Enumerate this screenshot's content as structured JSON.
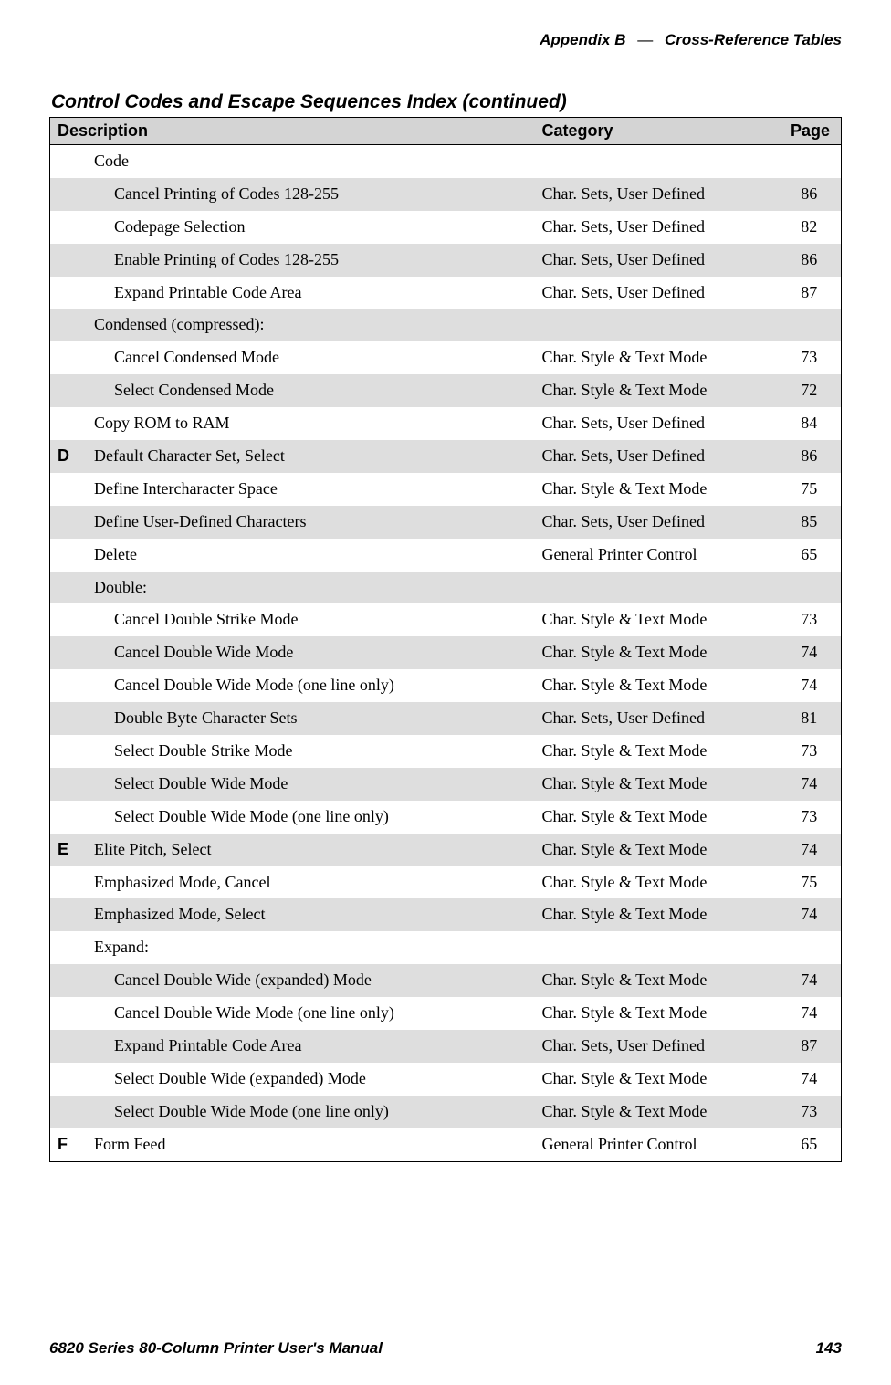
{
  "header": {
    "appendix": "Appendix B",
    "separator": "—",
    "title": "Cross-Reference Tables"
  },
  "table_title": "Control Codes and Escape Sequences Index (continued)",
  "columns": {
    "description": "Description",
    "category": "Category",
    "page": "Page"
  },
  "rows": [
    {
      "letter": "",
      "indent": 1,
      "desc": "Code",
      "cat": "",
      "page": "",
      "shade": false
    },
    {
      "letter": "",
      "indent": 2,
      "desc": "Cancel Printing of Codes 128-255",
      "cat": "Char. Sets, User Defined",
      "page": "86",
      "shade": true
    },
    {
      "letter": "",
      "indent": 2,
      "desc": "Codepage Selection",
      "cat": "Char. Sets, User Defined",
      "page": "82",
      "shade": false
    },
    {
      "letter": "",
      "indent": 2,
      "desc": "Enable Printing of Codes 128-255",
      "cat": "Char. Sets, User Defined",
      "page": "86",
      "shade": true
    },
    {
      "letter": "",
      "indent": 2,
      "desc": "Expand Printable Code Area",
      "cat": "Char. Sets, User Defined",
      "page": "87",
      "shade": false
    },
    {
      "letter": "",
      "indent": 1,
      "desc": "Condensed (compressed):",
      "cat": "",
      "page": "",
      "shade": true
    },
    {
      "letter": "",
      "indent": 2,
      "desc": "Cancel Condensed Mode",
      "cat": "Char. Style & Text Mode",
      "page": "73",
      "shade": false
    },
    {
      "letter": "",
      "indent": 2,
      "desc": "Select Condensed Mode",
      "cat": "Char. Style & Text Mode",
      "page": "72",
      "shade": true
    },
    {
      "letter": "",
      "indent": 1,
      "desc": "Copy ROM to RAM",
      "cat": "Char. Sets, User Defined",
      "page": "84",
      "shade": false
    },
    {
      "letter": "D",
      "indent": 1,
      "desc": "Default Character Set, Select",
      "cat": "Char. Sets, User Defined",
      "page": "86",
      "shade": true
    },
    {
      "letter": "",
      "indent": 1,
      "desc": "Define Intercharacter Space",
      "cat": "Char. Style & Text Mode",
      "page": "75",
      "shade": false
    },
    {
      "letter": "",
      "indent": 1,
      "desc": "Define User-Defined Characters",
      "cat": "Char. Sets, User Defined",
      "page": "85",
      "shade": true
    },
    {
      "letter": "",
      "indent": 1,
      "desc": "Delete",
      "cat": "General Printer Control",
      "page": "65",
      "shade": false
    },
    {
      "letter": "",
      "indent": 1,
      "desc": "Double:",
      "cat": "",
      "page": "",
      "shade": true
    },
    {
      "letter": "",
      "indent": 2,
      "desc": "Cancel Double Strike Mode",
      "cat": "Char. Style & Text Mode",
      "page": "73",
      "shade": false
    },
    {
      "letter": "",
      "indent": 2,
      "desc": "Cancel Double Wide Mode",
      "cat": "Char. Style & Text Mode",
      "page": "74",
      "shade": true
    },
    {
      "letter": "",
      "indent": 2,
      "desc": "Cancel Double Wide Mode (one line only)",
      "cat": "Char. Style & Text Mode",
      "page": "74",
      "shade": false
    },
    {
      "letter": "",
      "indent": 2,
      "desc": "Double Byte Character Sets",
      "cat": "Char. Sets, User Defined",
      "page": "81",
      "shade": true
    },
    {
      "letter": "",
      "indent": 2,
      "desc": "Select Double Strike Mode",
      "cat": "Char. Style & Text Mode",
      "page": "73",
      "shade": false
    },
    {
      "letter": "",
      "indent": 2,
      "desc": "Select Double Wide Mode",
      "cat": "Char. Style & Text Mode",
      "page": "74",
      "shade": true
    },
    {
      "letter": "",
      "indent": 2,
      "desc": "Select Double Wide Mode (one line only)",
      "cat": "Char. Style & Text Mode",
      "page": "73",
      "shade": false
    },
    {
      "letter": "E",
      "indent": 1,
      "desc": "Elite Pitch, Select",
      "cat": "Char. Style & Text Mode",
      "page": "74",
      "shade": true
    },
    {
      "letter": "",
      "indent": 1,
      "desc": "Emphasized Mode, Cancel",
      "cat": "Char. Style & Text Mode",
      "page": "75",
      "shade": false
    },
    {
      "letter": "",
      "indent": 1,
      "desc": "Emphasized Mode, Select",
      "cat": "Char. Style & Text Mode",
      "page": "74",
      "shade": true
    },
    {
      "letter": "",
      "indent": 1,
      "desc": "Expand:",
      "cat": "",
      "page": "",
      "shade": false
    },
    {
      "letter": "",
      "indent": 2,
      "desc": "Cancel Double Wide (expanded) Mode",
      "cat": "Char. Style & Text Mode",
      "page": "74",
      "shade": true
    },
    {
      "letter": "",
      "indent": 2,
      "desc": "Cancel Double Wide Mode (one line only)",
      "cat": "Char. Style & Text Mode",
      "page": "74",
      "shade": false
    },
    {
      "letter": "",
      "indent": 2,
      "desc": "Expand Printable Code Area",
      "cat": "Char. Sets, User Defined",
      "page": "87",
      "shade": true
    },
    {
      "letter": "",
      "indent": 2,
      "desc": "Select Double Wide (expanded) Mode",
      "cat": "Char. Style & Text Mode",
      "page": "74",
      "shade": false
    },
    {
      "letter": "",
      "indent": 2,
      "desc": "Select Double Wide Mode (one line only)",
      "cat": "Char. Style & Text Mode",
      "page": "73",
      "shade": true
    },
    {
      "letter": "F",
      "indent": 1,
      "desc": "Form Feed",
      "cat": "General Printer Control",
      "page": "65",
      "shade": false
    }
  ],
  "footer": {
    "left": "6820 Series 80-Column Printer User's Manual",
    "right": "143"
  }
}
